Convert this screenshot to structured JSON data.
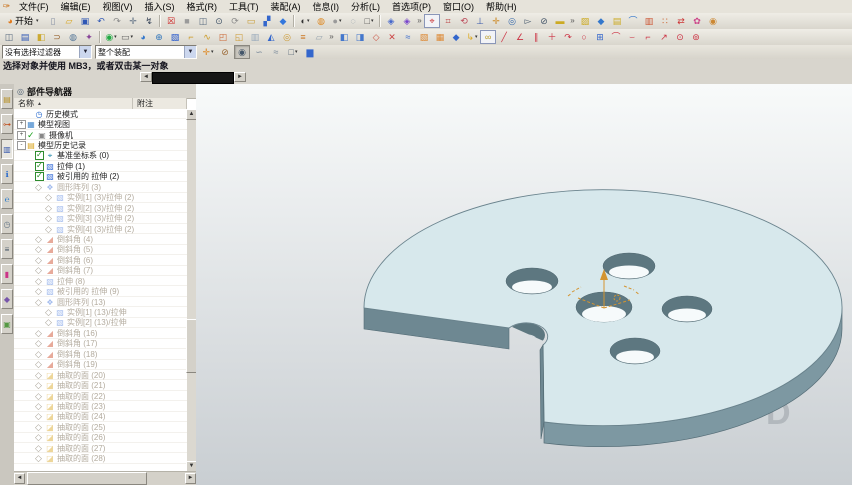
{
  "menu_bar": {
    "app_icon_glyph": "✑",
    "items": [
      {
        "label": "文件(F)"
      },
      {
        "label": "编辑(E)"
      },
      {
        "label": "视图(V)"
      },
      {
        "label": "插入(S)"
      },
      {
        "label": "格式(R)"
      },
      {
        "label": "工具(T)"
      },
      {
        "label": "装配(A)"
      },
      {
        "label": "信息(I)"
      },
      {
        "label": "分析(L)"
      },
      {
        "label": "首选项(P)"
      },
      {
        "label": "窗口(O)"
      },
      {
        "label": "帮助(H)"
      }
    ]
  },
  "toolbar1": {
    "start_label": "开始",
    "start_glyph": "◕",
    "start_color": "#e07818",
    "items": [
      {
        "n": "new-file-button",
        "g": "▯",
        "c": "#8a93a6"
      },
      {
        "n": "open-file-button",
        "g": "▱",
        "c": "#d9a520"
      },
      {
        "n": "save-button",
        "g": "▣",
        "c": "#2f57b5"
      },
      {
        "n": "undo-button",
        "g": "↶",
        "c": "#2f57b5"
      },
      {
        "n": "redo-button",
        "g": "↷",
        "c": "#8a8a8a"
      },
      {
        "n": "touch-select-button",
        "g": "✛",
        "c": "#5a6c80"
      },
      {
        "n": "visualize-button",
        "g": "↯",
        "c": "#39465a"
      },
      {
        "n": "toolbar-separator",
        "cls": "sep",
        "inter": false
      },
      {
        "n": "display-window-button",
        "g": "☒",
        "c": "#cc2222"
      },
      {
        "n": "fill-box-button",
        "g": "■",
        "c": "#9a9a9a"
      },
      {
        "n": "capture-button",
        "g": "◫",
        "c": "#5a6c80"
      },
      {
        "n": "zoom-button",
        "g": "⊙",
        "c": "#44566a"
      },
      {
        "n": "refresh-button",
        "g": "⟳",
        "c": "#8a8a8a"
      },
      {
        "n": "image-button",
        "g": "▭",
        "c": "#c79a33"
      },
      {
        "n": "brush-button",
        "g": "▞",
        "c": "#3366cc"
      },
      {
        "n": "cube-button",
        "g": "◆",
        "c": "#3377dd"
      },
      {
        "n": "toolbar-separator",
        "cls": "sep",
        "inter": false
      },
      {
        "n": "render-style-button",
        "g": "◐",
        "c": "#333333",
        "cls": "dd"
      },
      {
        "n": "render-object-button",
        "g": "◍",
        "c": "#dd8822"
      },
      {
        "n": "sphere-style-button",
        "g": "●",
        "c": "#9a9a9a",
        "cls": "dd"
      },
      {
        "n": "face-edit-button",
        "g": "◌",
        "c": "#7a8a99"
      },
      {
        "n": "view-box-button",
        "g": "□",
        "c": "#555555",
        "cls": "dd"
      },
      {
        "n": "toolbar-separator",
        "cls": "sep",
        "inter": false
      },
      {
        "n": "iso-view-button",
        "g": "◈",
        "c": "#4466cc"
      },
      {
        "n": "trimetric-view-button",
        "g": "◈",
        "c": "#7744cc"
      },
      {
        "n": "toolbar-overflow",
        "g": "»",
        "c": "#555",
        "cls": "ovf"
      },
      {
        "n": "csys-button",
        "g": "⌖",
        "c": "#cc3333",
        "cls": "boxed"
      },
      {
        "n": "csys-dynamic-button",
        "g": "⌗",
        "c": "#bb4444"
      },
      {
        "n": "csys-rotate-button",
        "g": "⟲",
        "c": "#bb4455"
      },
      {
        "n": "datum-axis-button",
        "g": "⊥",
        "c": "#3355aa"
      },
      {
        "n": "point-button",
        "g": "✛",
        "c": "#cc8822"
      },
      {
        "n": "snap-point-button",
        "g": "◎",
        "c": "#3366aa"
      },
      {
        "n": "select-button",
        "g": "▻",
        "c": "#44566a"
      },
      {
        "n": "deselect-button",
        "g": "⊘",
        "c": "#44566a"
      },
      {
        "n": "ruler-button",
        "g": "▬",
        "c": "#ccaa22"
      },
      {
        "n": "toolbar-overflow",
        "g": "»",
        "c": "#555",
        "cls": "ovf"
      },
      {
        "n": "section-button",
        "g": "▨",
        "c": "#ccaa22"
      },
      {
        "n": "diamond-button",
        "g": "◆",
        "c": "#3377cc"
      },
      {
        "n": "layers-button",
        "g": "▤",
        "c": "#ccaa22"
      },
      {
        "n": "arc-tool-button",
        "g": "⌒",
        "c": "#3377cc"
      },
      {
        "n": "comb-button",
        "g": "▥",
        "c": "#cc5533"
      },
      {
        "n": "pattern-button",
        "g": "∷",
        "c": "#cc6633"
      },
      {
        "n": "swap-button",
        "g": "⇄",
        "c": "#cc3333"
      },
      {
        "n": "flower-button",
        "g": "✿",
        "c": "#cc4488"
      },
      {
        "n": "ball-button",
        "g": "◉",
        "c": "#cc8833"
      }
    ]
  },
  "toolbar2": {
    "items": [
      {
        "n": "window-layout-button",
        "g": "◫",
        "c": "#5a6c80"
      },
      {
        "n": "book-button",
        "g": "▤",
        "c": "#2f57b5"
      },
      {
        "n": "shapes-button",
        "g": "◧",
        "c": "#ccaa33"
      },
      {
        "n": "magnet-button",
        "g": "⊃",
        "c": "#996633"
      },
      {
        "n": "view-sphere-button",
        "g": "◍",
        "c": "#557799"
      },
      {
        "n": "avatar-button",
        "g": "✦",
        "c": "#884499"
      },
      {
        "n": "toolbar-separator",
        "cls": "sep",
        "inter": false
      },
      {
        "n": "sketch-button",
        "g": "◉",
        "c": "#22aa44",
        "cls": "dd"
      },
      {
        "n": "rect-tool-button",
        "g": "▭",
        "c": "#666666",
        "cls": "dd"
      },
      {
        "n": "datum-plane-button",
        "g": "◕",
        "c": "#3377cc"
      },
      {
        "n": "globe-button",
        "g": "⊕",
        "c": "#3377bb"
      },
      {
        "n": "block-button",
        "g": "▧",
        "c": "#2255cc"
      },
      {
        "n": "hook-button",
        "g": "⌐",
        "c": "#cc9922"
      },
      {
        "n": "sweep-button",
        "g": "∿",
        "c": "#cc9922"
      },
      {
        "n": "pad-button",
        "g": "◰",
        "c": "#cc6633"
      },
      {
        "n": "boss-button",
        "g": "◱",
        "c": "#cc9933"
      },
      {
        "n": "column-button",
        "g": "▥",
        "c": "#99aabb"
      },
      {
        "n": "wedge-button",
        "g": "◭",
        "c": "#3366cc"
      },
      {
        "n": "donut-button",
        "g": "◎",
        "c": "#cc9933"
      },
      {
        "n": "stack-button",
        "g": "≡",
        "c": "#cc7722"
      },
      {
        "n": "plane-button",
        "g": "▱",
        "c": "#99a5b0"
      },
      {
        "n": "toolbar-overflow",
        "g": "»",
        "c": "#555",
        "cls": "ovf"
      },
      {
        "n": "mirror-left-button",
        "g": "◧",
        "c": "#4477cc"
      },
      {
        "n": "mirror-right-button",
        "g": "◨",
        "c": "#4477cc"
      },
      {
        "n": "patch-button",
        "g": "◇",
        "c": "#cc5544"
      },
      {
        "n": "trim-body-button",
        "g": "✕",
        "c": "#cc4444"
      },
      {
        "n": "sew-button",
        "g": "≈",
        "c": "#3366cc"
      },
      {
        "n": "emboss-button",
        "g": "▧",
        "c": "#dd8833"
      },
      {
        "n": "window-feature-button",
        "g": "▦",
        "c": "#dd8833"
      },
      {
        "n": "cube2-button",
        "g": "◆",
        "c": "#3366cc"
      },
      {
        "n": "offset-button",
        "g": "↳",
        "c": "#ddaa22",
        "cls": "dd"
      },
      {
        "n": "profile-button",
        "g": "∞",
        "c": "#b89a22",
        "cls": "boxed"
      },
      {
        "n": "line-button",
        "g": "╱",
        "c": "#cc3344"
      },
      {
        "n": "point-set-button",
        "g": "∠",
        "c": "#cc3344"
      },
      {
        "n": "parallel-button",
        "g": "∥",
        "c": "#cc3344"
      },
      {
        "n": "plus-button",
        "g": "＋",
        "c": "#cc3344"
      },
      {
        "n": "arc-button",
        "g": "↷",
        "c": "#cc3344"
      },
      {
        "n": "circle-button",
        "g": "○",
        "c": "#cc3344"
      },
      {
        "n": "grid-cube-button",
        "g": "⊞",
        "c": "#3366cc"
      },
      {
        "n": "fillet-button",
        "g": "⌒",
        "c": "#cc3344"
      },
      {
        "n": "arc2-button",
        "g": "⌣",
        "c": "#cc3344"
      },
      {
        "n": "trim-button",
        "g": "⌐",
        "c": "#cc3344"
      },
      {
        "n": "extend-button",
        "g": "↗",
        "c": "#cc3344"
      },
      {
        "n": "circle-target-button",
        "g": "⊙",
        "c": "#cc3344"
      },
      {
        "n": "circle-target2-button",
        "g": "⊚",
        "c": "#cc3344"
      }
    ]
  },
  "selection_bar": {
    "filter_value": "没有选择过滤器",
    "scope_value": "整个装配",
    "arrow_glyph": "▼",
    "buttons": [
      {
        "n": "snap-point-toggle",
        "g": "✛",
        "c": "#dd8822",
        "cls": "dd"
      },
      {
        "n": "stop-selection-button",
        "g": "⊘",
        "c": "#996633"
      },
      {
        "n": "highlight-button",
        "g": "◉",
        "c": "#44566a",
        "cls": "pressed"
      },
      {
        "n": "curve-rule-button",
        "g": "∽",
        "c": "#778899"
      },
      {
        "n": "lasso-button",
        "g": "≈",
        "c": "#778899"
      },
      {
        "n": "marquee-button",
        "g": "□",
        "c": "#556677",
        "cls": "dd"
      },
      {
        "n": "paint-select-button",
        "g": "▆",
        "c": "#3366cc"
      }
    ]
  },
  "prompt_bar": {
    "text": "选择对象并使用 MB3，或者双击某一对象"
  },
  "tab_scroller": {
    "left_glyph": "◄",
    "right_glyph": "►"
  },
  "left_toolbar": {
    "items": [
      {
        "n": "assembly-navigator-button",
        "g": "▤",
        "c": "#b8932a"
      },
      {
        "n": "constraint-navigator-button",
        "g": "⊶",
        "c": "#c05020"
      },
      {
        "n": "part-navigator-button",
        "g": "▥",
        "c": "#3355aa",
        "cls": "active"
      },
      {
        "n": "information-button",
        "g": "ℹ",
        "c": "#2266cc"
      },
      {
        "n": "web-browser-button",
        "g": "℮",
        "c": "#2277cc"
      },
      {
        "n": "history-button",
        "g": "◷",
        "c": "#667788"
      },
      {
        "n": "system-materials-button",
        "g": "≡",
        "c": "#445566"
      },
      {
        "n": "palette-button",
        "g": "▮",
        "c": "#cc3388"
      },
      {
        "n": "manipulation-button",
        "g": "◆",
        "c": "#7755aa"
      },
      {
        "n": "scene-button",
        "g": "▣",
        "c": "#559944"
      }
    ]
  },
  "navigator": {
    "title": "部件导航器",
    "pin_icon_glyph": "◎",
    "sort_arrow": "▲",
    "columns": {
      "name": "名称",
      "note": "附注"
    },
    "tree": [
      {
        "ind": "i1",
        "icon": "clock",
        "label": "历史模式"
      },
      {
        "ind": "i0",
        "exp": "+",
        "icon": "views",
        "label": "模型视图"
      },
      {
        "ind": "i0",
        "exp": "+",
        "chk": "tick",
        "icon": "camera",
        "label": "摄像机"
      },
      {
        "ind": "i0",
        "exp": "-",
        "icon": "folder",
        "label": "模型历史记录"
      },
      {
        "ind": "i1",
        "chk": "on",
        "icon": "csys",
        "label": "基准坐标系 (0)"
      },
      {
        "ind": "i1",
        "chk": "on",
        "icon": "extrude",
        "label": "拉伸 (1)"
      },
      {
        "ind": "i1",
        "chk": "on",
        "icon": "extrude",
        "label": "被引用的 拉伸 (2)"
      },
      {
        "ind": "i1",
        "chk": "sup",
        "icon": "pattern",
        "label": "圆形阵列 (3)",
        "state": "gray"
      },
      {
        "ind": "i2",
        "chk": "sup",
        "icon": "extrude",
        "label": "实例[1] (3)/拉伸 (2)",
        "state": "gray"
      },
      {
        "ind": "i2",
        "chk": "sup",
        "icon": "extrude",
        "label": "实例[2] (3)/拉伸 (2)",
        "state": "gray"
      },
      {
        "ind": "i2",
        "chk": "sup",
        "icon": "extrude",
        "label": "实例[3] (3)/拉伸 (2)",
        "state": "gray"
      },
      {
        "ind": "i2",
        "chk": "sup",
        "icon": "extrude",
        "label": "实例[4] (3)/拉伸 (2)",
        "state": "gray"
      },
      {
        "ind": "i1",
        "chk": "sup",
        "icon": "chamfer",
        "label": "倒斜角 (4)",
        "state": "gray"
      },
      {
        "ind": "i1",
        "chk": "sup",
        "icon": "chamfer",
        "label": "倒斜角 (5)",
        "state": "gray"
      },
      {
        "ind": "i1",
        "chk": "sup",
        "icon": "chamfer",
        "label": "倒斜角 (6)",
        "state": "gray"
      },
      {
        "ind": "i1",
        "chk": "sup",
        "icon": "chamfer",
        "label": "倒斜角 (7)",
        "state": "gray"
      },
      {
        "ind": "i1",
        "chk": "sup",
        "icon": "extrude",
        "label": "拉伸 (8)",
        "state": "gray"
      },
      {
        "ind": "i1",
        "chk": "sup",
        "icon": "extrude",
        "label": "被引用的 拉伸 (9)",
        "state": "gray"
      },
      {
        "ind": "i1",
        "chk": "sup",
        "icon": "pattern",
        "label": "圆形阵列 (13)",
        "state": "gray"
      },
      {
        "ind": "i2",
        "chk": "sup",
        "icon": "extrude",
        "label": "实例[1] (13)/拉伸",
        "state": "gray"
      },
      {
        "ind": "i2",
        "chk": "sup",
        "icon": "extrude",
        "label": "实例[2] (13)/拉伸",
        "state": "gray"
      },
      {
        "ind": "i1",
        "chk": "sup",
        "icon": "chamfer",
        "label": "倒斜角 (16)",
        "state": "gray"
      },
      {
        "ind": "i1",
        "chk": "sup",
        "icon": "chamfer",
        "label": "倒斜角 (17)",
        "state": "gray"
      },
      {
        "ind": "i1",
        "chk": "sup",
        "icon": "chamfer",
        "label": "倒斜角 (18)",
        "state": "gray"
      },
      {
        "ind": "i1",
        "chk": "sup",
        "icon": "chamfer",
        "label": "倒斜角 (19)",
        "state": "gray"
      },
      {
        "ind": "i1",
        "chk": "sup",
        "icon": "xface",
        "label": "抽取的面 (20)",
        "state": "gray"
      },
      {
        "ind": "i1",
        "chk": "sup",
        "icon": "xface",
        "label": "抽取的面 (21)",
        "state": "gray"
      },
      {
        "ind": "i1",
        "chk": "sup",
        "icon": "xface",
        "label": "抽取的面 (22)",
        "state": "gray"
      },
      {
        "ind": "i1",
        "chk": "sup",
        "icon": "xface",
        "label": "抽取的面 (23)",
        "state": "gray"
      },
      {
        "ind": "i1",
        "chk": "sup",
        "icon": "xface",
        "label": "抽取的面 (24)",
        "state": "gray"
      },
      {
        "ind": "i1",
        "chk": "sup",
        "icon": "xface",
        "label": "抽取的面 (25)",
        "state": "gray"
      },
      {
        "ind": "i1",
        "chk": "sup",
        "icon": "xface",
        "label": "抽取的面 (26)",
        "state": "gray"
      },
      {
        "ind": "i1",
        "chk": "sup",
        "icon": "xface",
        "label": "抽取的面 (27)",
        "state": "gray"
      },
      {
        "ind": "i1",
        "chk": "sup",
        "icon": "xface",
        "label": "抽取的面 (28)",
        "state": "gray"
      }
    ]
  },
  "icon_map": {
    "clock": {
      "g": "◷",
      "c": "#2266cc"
    },
    "views": {
      "g": "▦",
      "c": "#4488cc"
    },
    "camera": {
      "g": "▣",
      "c": "#888888"
    },
    "folder": {
      "g": "▤",
      "c": "#d9a520"
    },
    "csys": {
      "g": "⌖",
      "c": "#2288aa"
    },
    "extrude": {
      "g": "▧",
      "c": "#3a6fd8"
    },
    "pattern": {
      "g": "❖",
      "c": "#3a6fd8"
    },
    "chamfer": {
      "g": "◢",
      "c": "#cc4422"
    },
    "xface": {
      "g": "◪",
      "c": "#d9a520"
    }
  },
  "scrollbars": {
    "up": "▲",
    "down": "▼",
    "left": "◄",
    "right": "►"
  },
  "viewport": {
    "watermark": "D",
    "colors": {
      "bg_top": "#f8fafa",
      "bg_bottom": "#c9ced2",
      "top_face": "#d7e8ec",
      "side": "#7d98a2",
      "side_dark": "#6e8892",
      "hole": "#5d7780",
      "hole_light": "#f6fafb",
      "outline": "#5e7680",
      "axis": "#d49430",
      "watermark_color": "#a9afb4"
    }
  }
}
